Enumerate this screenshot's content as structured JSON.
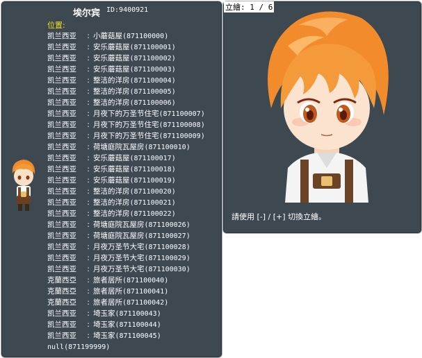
{
  "npc": {
    "name": "埃尔宾",
    "id": "ID:9400921"
  },
  "location_header": "位置:",
  "maps": [
    {
      "region": "凯兰西亚",
      "name": "小蘑菇屋",
      "code": "(871100000)"
    },
    {
      "region": "凯兰西亚",
      "name": "安乐蘑菇屋",
      "code": "(871100001)"
    },
    {
      "region": "凯兰西亚",
      "name": "安乐蘑菇屋",
      "code": "(871100002)"
    },
    {
      "region": "凯兰西亚",
      "name": "安乐蘑菇屋",
      "code": "(871100003)"
    },
    {
      "region": "凯兰西亚",
      "name": "整洁的洋房",
      "code": "(871100004)"
    },
    {
      "region": "凯兰西亚",
      "name": "整洁的洋房",
      "code": "(871100005)"
    },
    {
      "region": "凯兰西亚",
      "name": "整洁的洋房",
      "code": "(871100006)"
    },
    {
      "region": "凯兰西亚",
      "name": "月夜下的万圣节住宅",
      "code": "(871100007)"
    },
    {
      "region": "凯兰西亚",
      "name": "月夜下的万圣节住宅",
      "code": "(871100008)"
    },
    {
      "region": "凯兰西亚",
      "name": "月夜下的万圣节住宅",
      "code": "(871100009)"
    },
    {
      "region": "凯兰西亚",
      "name": "荷塘庭院瓦屋房",
      "code": "(871100010)"
    },
    {
      "region": "凯兰西亚",
      "name": "安乐蘑菇屋",
      "code": "(871100017)"
    },
    {
      "region": "凯兰西亚",
      "name": "安乐蘑菇屋",
      "code": "(871100018)"
    },
    {
      "region": "凯兰西亚",
      "name": "安乐蘑菇屋",
      "code": "(871100019)"
    },
    {
      "region": "凯兰西亚",
      "name": "整洁的洋房",
      "code": "(871100020)"
    },
    {
      "region": "凯兰西亚",
      "name": "整洁的洋房",
      "code": "(871100021)"
    },
    {
      "region": "凯兰西亚",
      "name": "整洁的洋房",
      "code": "(871100022)"
    },
    {
      "region": "凯兰西亚",
      "name": "荷塘庭院瓦屋房",
      "code": "(871100026)"
    },
    {
      "region": "凯兰西亚",
      "name": "荷塘庭院瓦屋房",
      "code": "(871100027)"
    },
    {
      "region": "凯兰西亚",
      "name": "月夜万圣节大宅",
      "code": "(871100028)"
    },
    {
      "region": "凯兰西亚",
      "name": "月夜万圣节大宅",
      "code": "(871100029)"
    },
    {
      "region": "凯兰西亚",
      "name": "月夜万圣节大宅",
      "code": "(871100030)"
    },
    {
      "region": "克蘭西亞",
      "name": "旅者居所",
      "code": "(871100040)"
    },
    {
      "region": "克蘭西亞",
      "name": "旅者居所",
      "code": "(871100041)"
    },
    {
      "region": "克蘭西亞",
      "name": "旅者居所",
      "code": "(871100042)"
    },
    {
      "region": "凯兰西亚",
      "name": "埼玉家",
      "code": "(871100043)"
    },
    {
      "region": "凯兰西亚",
      "name": "埼玉家",
      "code": "(871100044)"
    },
    {
      "region": "凯兰西亚",
      "name": "埼玉家",
      "code": "(871100045)"
    },
    {
      "region": "",
      "name": "",
      "code": "null(871199999)"
    }
  ],
  "separator": ":",
  "stand_label": "立繪: 1 / 6",
  "hint": "請使用 [-] / [+] 切換立繪。",
  "colors": {
    "panel": "#3d4850",
    "header_yellow": "#f0e020",
    "hair": "#f08a2a"
  }
}
